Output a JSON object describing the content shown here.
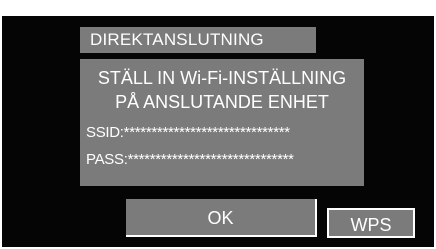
{
  "dialog": {
    "title": "DIREKTANSLUTNING",
    "message_line_1": "STÄLL IN Wi-Fi-INSTÄLLNING",
    "message_line_2": "PÅ ANSLUTANDE ENHET",
    "ssid": "SSID:******************************",
    "pass": "PASS:******************************"
  },
  "buttons": {
    "ok_label": "OK",
    "wps_label": "WPS"
  },
  "colors": {
    "background": "#050505",
    "panel_gray": "#7b7b7b",
    "text": "#ffffff"
  }
}
